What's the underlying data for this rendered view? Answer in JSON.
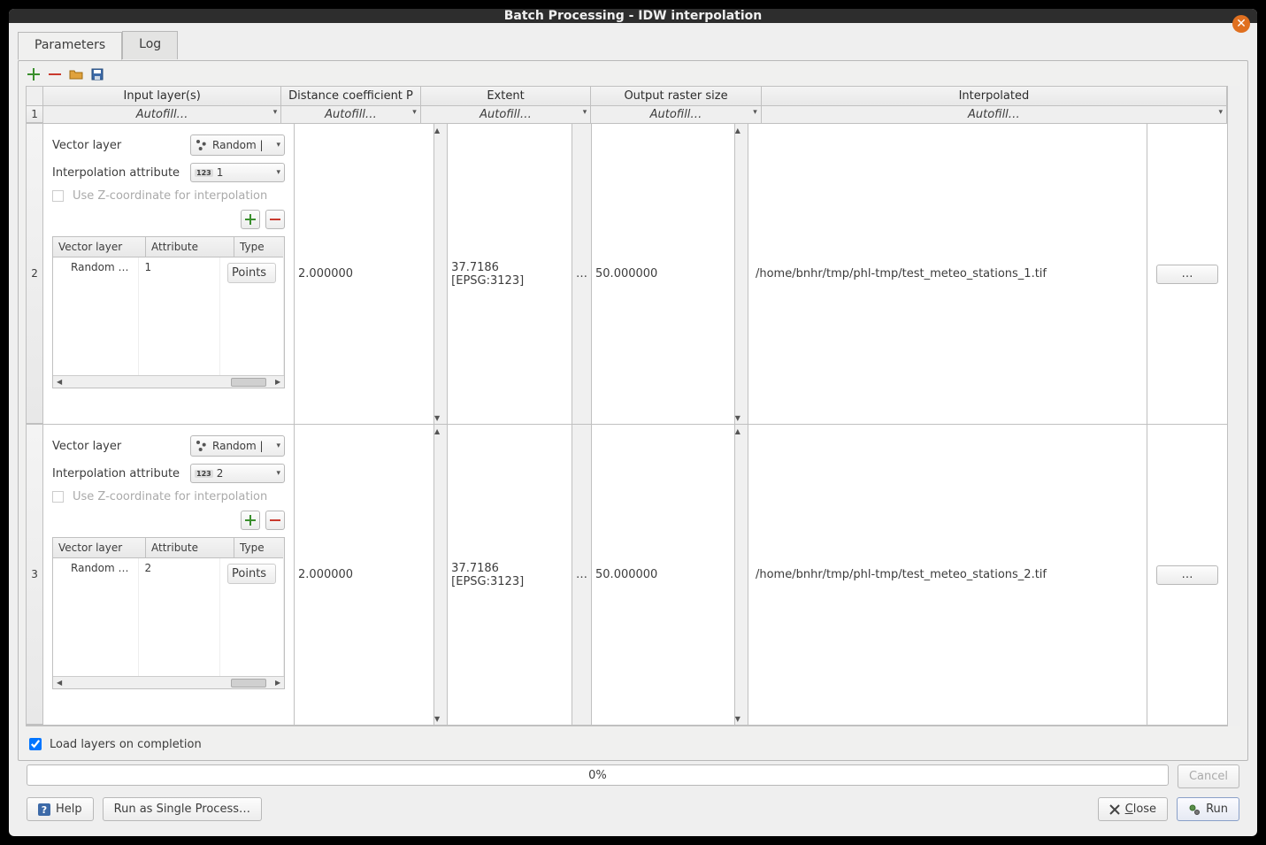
{
  "title": "Batch Processing - IDW interpolation",
  "tabs": {
    "parameters": "Parameters",
    "log": "Log"
  },
  "columns": {
    "input": "Input layer(s)",
    "distance": "Distance coefficient P",
    "extent": "Extent",
    "raster": "Output raster size",
    "interpolated": "Interpolated"
  },
  "autofill": "Autofill…",
  "form": {
    "vector_layer": "Vector layer",
    "interp_attr": "Interpolation attribute",
    "use_z": "Use Z-coordinate for interpolation"
  },
  "inner_headers": {
    "vl": "Vector layer",
    "attr": "Attribute",
    "type": "Type"
  },
  "rows": [
    {
      "vector_layer": "Random |",
      "attr_select": "1",
      "inner": {
        "vl": "Random …",
        "attr": "1",
        "type": "Points"
      },
      "distance": "2.000000",
      "extent": "37.7186 [EPSG:3123]",
      "raster": "50.000000",
      "interpolated": "/home/bnhr/tmp/phl-tmp/test_meteo_stations_1.tif"
    },
    {
      "vector_layer": "Random |",
      "attr_select": "2",
      "inner": {
        "vl": "Random …",
        "attr": "2",
        "type": "Points"
      },
      "distance": "2.000000",
      "extent": "37.7186 [EPSG:3123]",
      "raster": "50.000000",
      "interpolated": "/home/bnhr/tmp/phl-tmp/test_meteo_stations_2.tif"
    }
  ],
  "dots_btn": "…",
  "ext_dots": "…",
  "load_layers": "Load layers on completion",
  "progress": "0%",
  "cancel": "Cancel",
  "help": "Help",
  "run_single": "Run as Single Process…",
  "close": "Close",
  "run": "Run",
  "attr_prefix": "123"
}
